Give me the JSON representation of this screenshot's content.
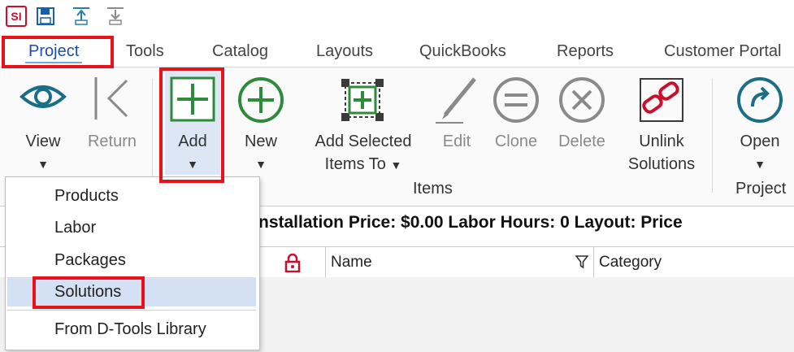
{
  "quick_access": {
    "logo_text": "SI",
    "icons": [
      "app-logo",
      "save-icon",
      "upload-icon",
      "download-icon"
    ]
  },
  "tabs": [
    {
      "label": "Project",
      "active": true
    },
    {
      "label": "Tools"
    },
    {
      "label": "Catalog"
    },
    {
      "label": "Layouts"
    },
    {
      "label": "QuickBooks"
    },
    {
      "label": "Reports"
    },
    {
      "label": "Customer Portal"
    }
  ],
  "ribbon": {
    "view": {
      "label": "View",
      "icon": "eye-icon"
    },
    "return": {
      "label": "Return",
      "icon": "chevron-left-icon"
    },
    "add": {
      "label": "Add",
      "icon": "plus-square-icon"
    },
    "new": {
      "label": "New",
      "icon": "plus-circle-icon"
    },
    "add_selected": {
      "label1": "Add Selected",
      "label2": "Items To",
      "icon": "add-selected-icon"
    },
    "edit": {
      "label": "Edit",
      "icon": "pen-icon"
    },
    "clone": {
      "label": "Clone",
      "icon": "clone-icon"
    },
    "delete": {
      "label": "Delete",
      "icon": "delete-circle-icon"
    },
    "unlink": {
      "label1": "Unlink",
      "label2": "Solutions",
      "icon": "unlink-chain-icon"
    },
    "open": {
      "label": "Open",
      "icon": "open-project-icon"
    },
    "groups": {
      "items": "Items",
      "project": "Project"
    }
  },
  "info_line": {
    "text": "nstallation Price: $0.00  Labor Hours: 0  Layout: Price"
  },
  "grid": {
    "columns": [
      "Name",
      "Category"
    ],
    "lock_icon": "padlock-icon",
    "filter_icon": "filter-icon"
  },
  "dropdown": {
    "items": [
      "Products",
      "Labor",
      "Packages",
      "Solutions",
      "From D-Tools Library"
    ],
    "highlighted": "Solutions"
  },
  "colors": {
    "highlight_red": "#e8121b",
    "accent_blue": "#1f4e9e",
    "icon_teal": "#1a6e86",
    "icon_green": "#2e8b3c"
  }
}
